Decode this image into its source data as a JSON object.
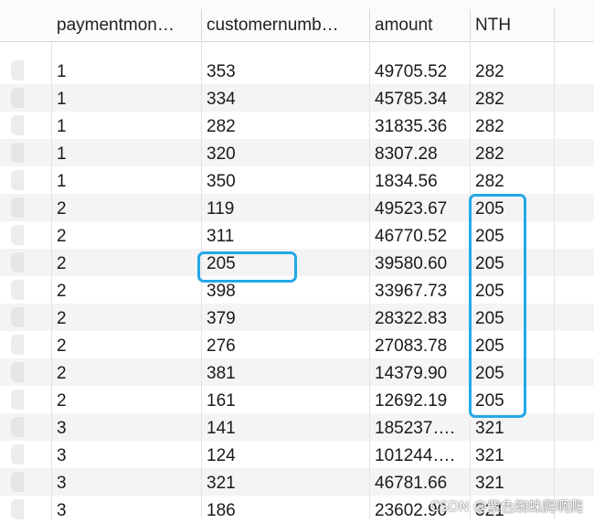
{
  "columns": [
    "paymentmon…",
    "customernumb…",
    "amount",
    "NTH"
  ],
  "rows": [
    [
      "1",
      "353",
      "49705.52",
      "282"
    ],
    [
      "1",
      "334",
      "45785.34",
      "282"
    ],
    [
      "1",
      "282",
      "31835.36",
      "282"
    ],
    [
      "1",
      "320",
      "8307.28",
      "282"
    ],
    [
      "1",
      "350",
      "1834.56",
      "282"
    ],
    [
      "2",
      "119",
      "49523.67",
      "205"
    ],
    [
      "2",
      "311",
      "46770.52",
      "205"
    ],
    [
      "2",
      "205",
      "39580.60",
      "205"
    ],
    [
      "2",
      "398",
      "33967.73",
      "205"
    ],
    [
      "2",
      "379",
      "28322.83",
      "205"
    ],
    [
      "2",
      "276",
      "27083.78",
      "205"
    ],
    [
      "2",
      "381",
      "14379.90",
      "205"
    ],
    [
      "2",
      "161",
      "12692.19",
      "205"
    ],
    [
      "3",
      "141",
      "185237….",
      "321"
    ],
    [
      "3",
      "124",
      "101244….",
      "321"
    ],
    [
      "3",
      "321",
      "46781.66",
      "321"
    ],
    [
      "3",
      "186",
      "23602.90",
      "321"
    ]
  ],
  "highlight_color": "#23a8e8",
  "watermark": "CSDN @紫色蜘蛛爬啊爬"
}
